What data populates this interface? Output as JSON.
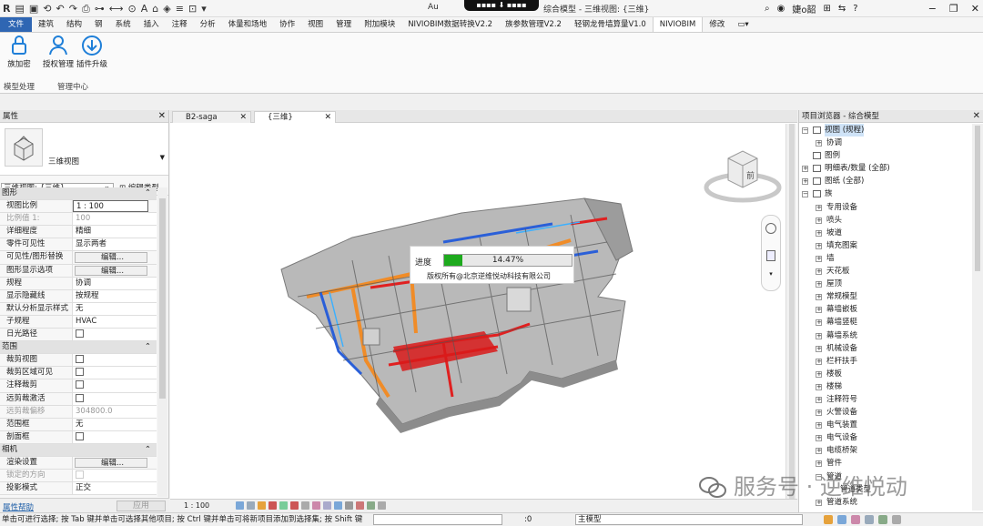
{
  "titlebar": {
    "title_left": "Au",
    "title_right": "综合模型 - 三维视图: {三维}",
    "user": "婕o韶",
    "help": "?"
  },
  "menubar": {
    "items": [
      "文件",
      "建筑",
      "结构",
      "钢",
      "系统",
      "插入",
      "注释",
      "分析",
      "体量和场地",
      "协作",
      "视图",
      "管理",
      "附加模块",
      "NIVIOBIM数据转换V2.2",
      "族参数管理V2.2",
      "轻钢龙骨墙算量V1.0",
      "NIVIOBIM",
      "修改"
    ],
    "active": "NIVIOBIM"
  },
  "ribbon": {
    "tools": [
      "族加密",
      "授权管理",
      "插件升级"
    ],
    "groups": [
      "模型处理",
      "管理中心"
    ]
  },
  "properties": {
    "title": "属性",
    "type_name": "三维视图",
    "selector": "三维视图: {三维}",
    "edit_type": "编辑类型",
    "rows": [
      {
        "k": "图形",
        "v": "",
        "kind": "sec"
      },
      {
        "k": "视图比例",
        "v": "1 : 100",
        "kind": "input"
      },
      {
        "k": "比例值 1:",
        "v": "100",
        "kind": "grey"
      },
      {
        "k": "详细程度",
        "v": "精细",
        "kind": "row"
      },
      {
        "k": "零件可见性",
        "v": "显示两者",
        "kind": "row"
      },
      {
        "k": "可见性/图形替换",
        "v": "编辑...",
        "kind": "btn"
      },
      {
        "k": "图形显示选项",
        "v": "编辑...",
        "kind": "btn"
      },
      {
        "k": "规程",
        "v": "协调",
        "kind": "row"
      },
      {
        "k": "显示隐藏线",
        "v": "按规程",
        "kind": "row"
      },
      {
        "k": "默认分析显示样式",
        "v": "无",
        "kind": "row"
      },
      {
        "k": "子规程",
        "v": "HVAC",
        "kind": "row"
      },
      {
        "k": "日光路径",
        "v": "",
        "kind": "cb"
      },
      {
        "k": "范围",
        "v": "",
        "kind": "sec"
      },
      {
        "k": "裁剪视图",
        "v": "",
        "kind": "cb"
      },
      {
        "k": "裁剪区域可见",
        "v": "",
        "kind": "cb"
      },
      {
        "k": "注释裁剪",
        "v": "",
        "kind": "cb"
      },
      {
        "k": "远剪裁激活",
        "v": "",
        "kind": "cb"
      },
      {
        "k": "远剪裁偏移",
        "v": "304800.0",
        "kind": "grey"
      },
      {
        "k": "范围框",
        "v": "无",
        "kind": "row"
      },
      {
        "k": "剖面框",
        "v": "",
        "kind": "cb"
      },
      {
        "k": "相机",
        "v": "",
        "kind": "sec"
      },
      {
        "k": "渲染设置",
        "v": "编辑...",
        "kind": "btn"
      },
      {
        "k": "锁定的方向",
        "v": "",
        "kind": "greycb"
      },
      {
        "k": "投影模式",
        "v": "正交",
        "kind": "row"
      }
    ],
    "help_link": "属性帮助",
    "apply": "应用"
  },
  "view": {
    "tabs": [
      "B2-saga",
      "{三维}"
    ],
    "progress_label": "进度",
    "progress_value": 14.47,
    "progress_text": "14.47%",
    "copyright": "版权所有@北京逆维悦动科技有限公司",
    "viewcube_label": "前",
    "scale": "1 : 100"
  },
  "browser": {
    "title": "项目浏览器 - 综合模型",
    "nodes": [
      {
        "l": "视图 (规程)",
        "d": 0,
        "e": "−",
        "i": "view",
        "sel": true
      },
      {
        "l": "协调",
        "d": 1,
        "e": "+",
        "i": ""
      },
      {
        "l": "图例",
        "d": 0,
        "e": "",
        "i": "doc"
      },
      {
        "l": "明细表/数量 (全部)",
        "d": 0,
        "e": "+",
        "i": "doc"
      },
      {
        "l": "图纸 (全部)",
        "d": 0,
        "e": "+",
        "i": "doc"
      },
      {
        "l": "族",
        "d": 0,
        "e": "−",
        "i": "doc"
      },
      {
        "l": "专用设备",
        "d": 1,
        "e": "+",
        "i": ""
      },
      {
        "l": "喷头",
        "d": 1,
        "e": "+",
        "i": ""
      },
      {
        "l": "坡道",
        "d": 1,
        "e": "+",
        "i": ""
      },
      {
        "l": "填充图案",
        "d": 1,
        "e": "+",
        "i": ""
      },
      {
        "l": "墙",
        "d": 1,
        "e": "+",
        "i": ""
      },
      {
        "l": "天花板",
        "d": 1,
        "e": "+",
        "i": ""
      },
      {
        "l": "屋顶",
        "d": 1,
        "e": "+",
        "i": ""
      },
      {
        "l": "常规模型",
        "d": 1,
        "e": "+",
        "i": ""
      },
      {
        "l": "幕墙嵌板",
        "d": 1,
        "e": "+",
        "i": ""
      },
      {
        "l": "幕墙竖梃",
        "d": 1,
        "e": "+",
        "i": ""
      },
      {
        "l": "幕墙系统",
        "d": 1,
        "e": "+",
        "i": ""
      },
      {
        "l": "机械设备",
        "d": 1,
        "e": "+",
        "i": ""
      },
      {
        "l": "栏杆扶手",
        "d": 1,
        "e": "+",
        "i": ""
      },
      {
        "l": "楼板",
        "d": 1,
        "e": "+",
        "i": ""
      },
      {
        "l": "楼梯",
        "d": 1,
        "e": "+",
        "i": ""
      },
      {
        "l": "注释符号",
        "d": 1,
        "e": "+",
        "i": ""
      },
      {
        "l": "火警设备",
        "d": 1,
        "e": "+",
        "i": ""
      },
      {
        "l": "电气装置",
        "d": 1,
        "e": "+",
        "i": ""
      },
      {
        "l": "电气设备",
        "d": 1,
        "e": "+",
        "i": ""
      },
      {
        "l": "电缆桥架",
        "d": 1,
        "e": "+",
        "i": ""
      },
      {
        "l": "管件",
        "d": 1,
        "e": "+",
        "i": ""
      },
      {
        "l": "管道",
        "d": 1,
        "e": "−",
        "i": ""
      },
      {
        "l": "管道类型",
        "d": 2,
        "e": "",
        "i": ""
      },
      {
        "l": "管道系统",
        "d": 1,
        "e": "+",
        "i": ""
      }
    ]
  },
  "watermark": "服务号 · 逆维悦动",
  "status": {
    "message": "单击可进行选择; 按 Tab 键并单击可选择其他项目; 按 Ctrl 键并单击可将新项目添加到选择集; 按 Shift 键",
    "zero1": ":0",
    "model": "主模型",
    "zero2": ":0"
  },
  "colors": {
    "file_tab": "#2f66b3",
    "progress_fill": "#1eaa1e",
    "duct_orange": "#f08c28",
    "pipe_red": "#e02020",
    "pipe_blue": "#2a5fd8"
  }
}
